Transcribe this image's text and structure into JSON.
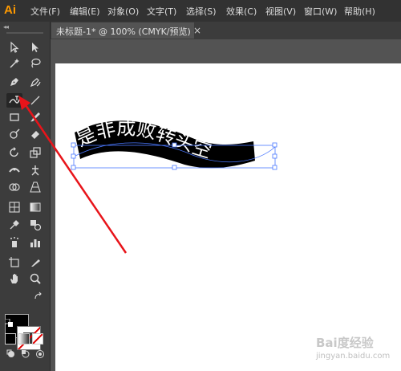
{
  "app": {
    "logo": "Ai"
  },
  "menu": [
    "文件(F)",
    "编辑(E)",
    "对象(O)",
    "文字(T)",
    "选择(S)",
    "效果(C)",
    "视图(V)",
    "窗口(W)",
    "帮助(H)"
  ],
  "tab": {
    "title": "未标题-1* @ 100% (CMYK/预览)",
    "close": "×"
  },
  "toolbar": {
    "grip": "◂◂",
    "tools": [
      "selection-tool-icon",
      "direct-selection-tool-icon",
      "magic-wand-tool-icon",
      "lasso-tool-icon",
      "pen-tool-icon",
      "curvature-tool-icon",
      "type-on-path-tool-icon",
      "line-segment-tool-icon",
      "rectangle-tool-icon",
      "paintbrush-tool-icon",
      "shaper-tool-icon",
      "eraser-tool-icon",
      "rotate-tool-icon",
      "scale-tool-icon",
      "width-tool-icon",
      "puppet-warp-tool-icon",
      "shape-builder-tool-icon",
      "perspective-grid-tool-icon",
      "mesh-tool-icon",
      "gradient-tool-icon",
      "eyedropper-tool-icon",
      "blend-tool-icon",
      "symbol-sprayer-tool-icon",
      "column-graph-tool-icon",
      "artboard-tool-icon",
      "slice-tool-icon",
      "hand-tool-icon",
      "zoom-tool-icon"
    ],
    "active_tool": "type-on-path-tool-icon"
  },
  "colors": {
    "fill": "#000000",
    "stroke": "none",
    "accent_arrow": "#e8141a",
    "selection": "#4a78ff"
  },
  "artwork": {
    "text": "是非成败转头空"
  },
  "watermark": {
    "brand": "Bai度经验",
    "url": "jingyan.baidu.com"
  }
}
